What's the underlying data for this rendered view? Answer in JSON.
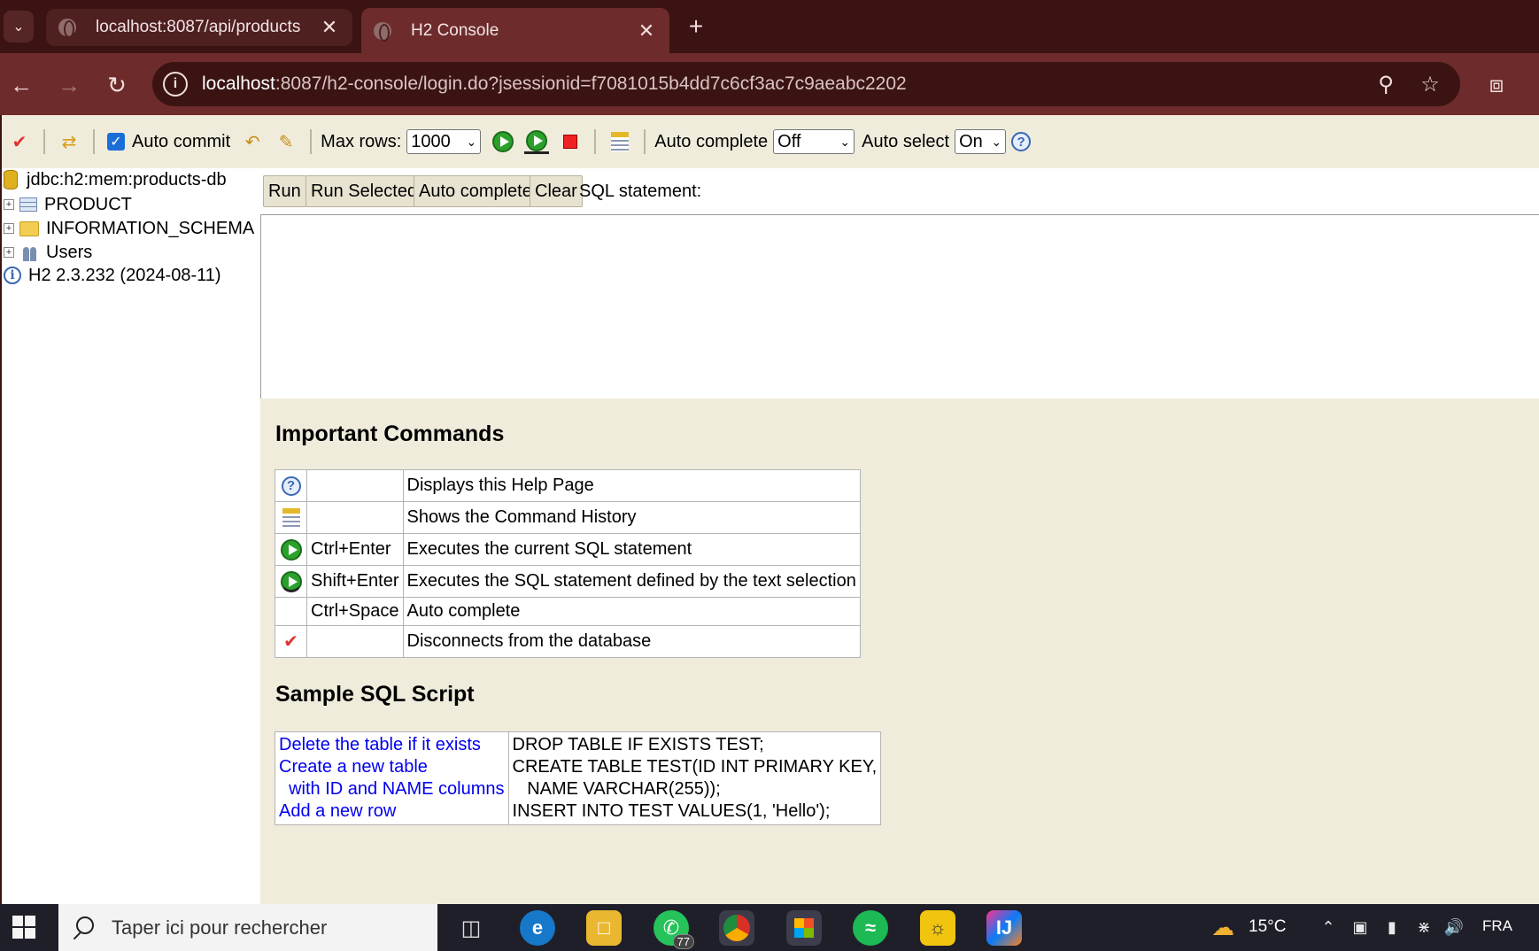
{
  "browser": {
    "tabs": [
      {
        "title": "localhost:8087/api/products",
        "active": false
      },
      {
        "title": "H2 Console",
        "active": true
      }
    ],
    "url_host": "localhost",
    "url_rest": ":8087/h2-console/login.do?jsessionid=f7081015b4dd7c6cf3ac7c9aeabc2202",
    "accent": "#6e2b2b"
  },
  "toolbar": {
    "auto_commit_label": "Auto commit",
    "auto_commit_checked": true,
    "max_rows_label": "Max rows:",
    "max_rows_value": "1000",
    "auto_complete_label": "Auto complete",
    "auto_complete_value": "Off",
    "auto_select_label": "Auto select",
    "auto_select_value": "On"
  },
  "tree": {
    "connection": "jdbc:h2:mem:products-db",
    "items": [
      {
        "label": "PRODUCT",
        "icon": "table-icon"
      },
      {
        "label": "INFORMATION_SCHEMA",
        "icon": "folder-icon"
      },
      {
        "label": "Users",
        "icon": "users-icon"
      }
    ],
    "version": "H2 2.3.232 (2024-08-11)"
  },
  "query": {
    "run_label": "Run",
    "run_selected_label": "Run Selected",
    "auto_complete_label": "Auto complete",
    "clear_label": "Clear",
    "sql_statement_label": "SQL statement:",
    "sql_text": ""
  },
  "help": {
    "important_title": "Important Commands",
    "commands": [
      {
        "icon": "help-icon",
        "key": "",
        "desc": "Displays this Help Page"
      },
      {
        "icon": "history-icon",
        "key": "",
        "desc": "Shows the Command History"
      },
      {
        "icon": "run-icon",
        "key": "Ctrl+Enter",
        "desc": "Executes the current SQL statement"
      },
      {
        "icon": "run-selected-icon",
        "key": "Shift+Enter",
        "desc": "Executes the SQL statement defined by the text selection"
      },
      {
        "icon": "",
        "key": "Ctrl+Space",
        "desc": "Auto complete"
      },
      {
        "icon": "disconnect-icon",
        "key": "",
        "desc": "Disconnects from the database"
      }
    ],
    "sample_title": "Sample SQL Script",
    "sample_left": [
      "Delete the table if it exists",
      "Create a new table",
      "  with ID and NAME columns",
      "Add a new row"
    ],
    "sample_right": [
      "DROP TABLE IF EXISTS TEST;",
      "CREATE TABLE TEST(ID INT PRIMARY KEY,",
      "   NAME VARCHAR(255));",
      "INSERT INTO TEST VALUES(1, 'Hello');"
    ]
  },
  "taskbar": {
    "search_placeholder": "Taper ici pour rechercher",
    "whatsapp_badge": "77",
    "temperature": "15°C",
    "language": "FRA"
  }
}
